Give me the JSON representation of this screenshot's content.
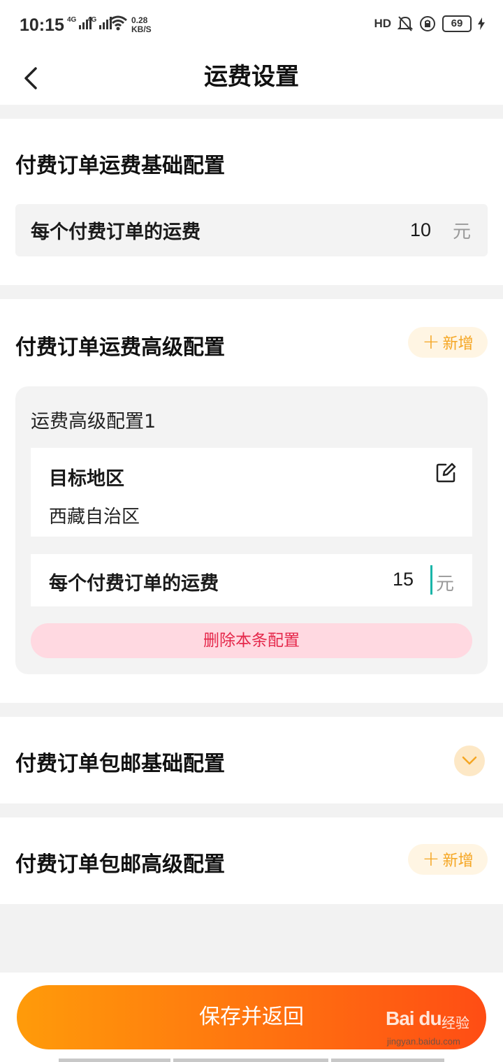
{
  "status_bar": {
    "time": "10:15",
    "network_1": "4G",
    "network_2": "4G",
    "speed_value": "0.28",
    "speed_unit": "KB/S",
    "hd_label": "HD",
    "battery": "69",
    "icons": [
      "signal-icon",
      "wifi-icon",
      "hd-icon",
      "bell-muted-icon",
      "rotation-lock-icon",
      "battery-icon",
      "charging-icon"
    ]
  },
  "nav": {
    "title": "运费设置",
    "back_icon": "chevron-left-icon"
  },
  "basic_config": {
    "title": "付费订单运费基础配置",
    "fee_label": "每个付费订单的运费",
    "fee_value": "10",
    "fee_unit": "元"
  },
  "advanced_config": {
    "title": "付费订单运费高级配置",
    "add_label": "新增",
    "items": [
      {
        "name": "运费高级配置1",
        "region_label": "目标地区",
        "region_value": "西藏自治区",
        "fee_label": "每个付费订单的运费",
        "fee_value": "15",
        "fee_unit": "元",
        "delete_label": "删除本条配置"
      }
    ]
  },
  "free_shipping_basic": {
    "title": "付费订单包邮基础配置",
    "expand_icon": "chevron-down-icon"
  },
  "free_shipping_advanced": {
    "title": "付费订单包邮高级配置",
    "add_label": "新增"
  },
  "footer": {
    "save_label": "保存并返回"
  },
  "watermark": {
    "logo": "Bai du",
    "text": "经验",
    "url": "jingyan.baidu.com"
  },
  "colors": {
    "accent_orange": "#ff7a10",
    "add_text": "#f5a623",
    "delete_text": "#e5274a",
    "cursor": "#19b5a8"
  }
}
